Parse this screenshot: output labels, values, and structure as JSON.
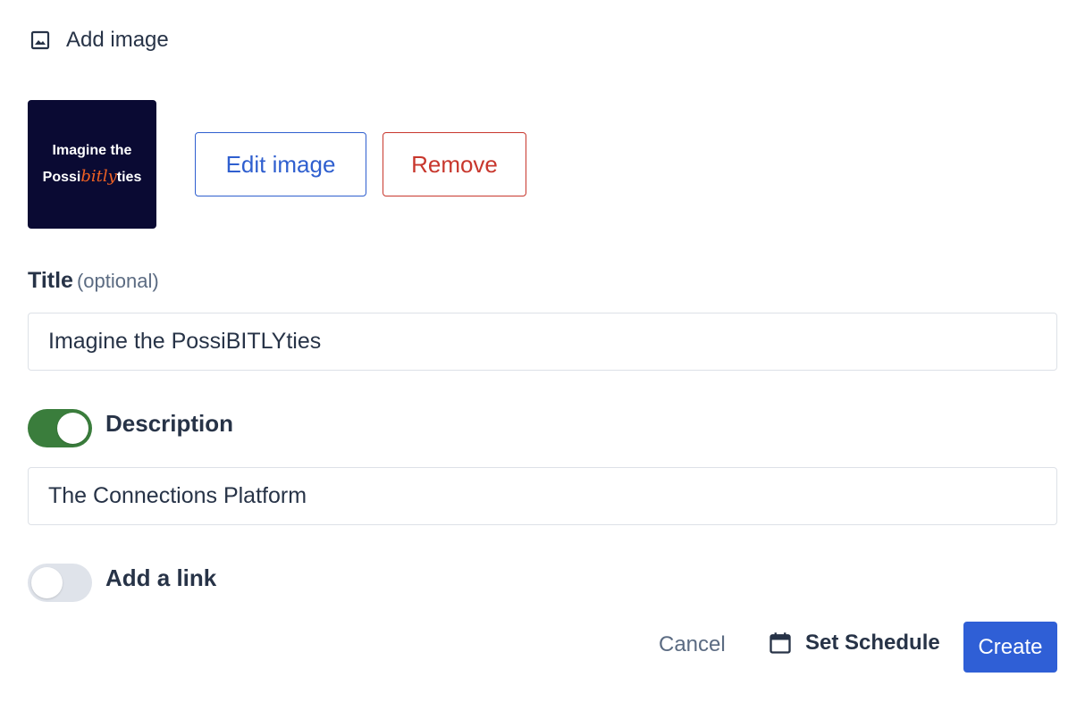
{
  "header": {
    "icon": "image-icon",
    "label": "Add image"
  },
  "thumbnail": {
    "line1": "Imagine the",
    "line2_prefix": "Possi",
    "line2_brand": "bitly",
    "line2_suffix": "ties",
    "background_color": "#0a0a33",
    "brand_color": "#ee6123"
  },
  "actions": {
    "edit_label": "Edit image",
    "remove_label": "Remove"
  },
  "title_field": {
    "label": "Title",
    "optional_hint": "(optional)",
    "value": "Imagine the PossiBITLYties"
  },
  "description": {
    "toggle_on": true,
    "label": "Description",
    "value": "The Connections Platform"
  },
  "link": {
    "toggle_on": false,
    "label": "Add a link"
  },
  "footer": {
    "cancel_label": "Cancel",
    "schedule_icon": "calendar-icon",
    "schedule_label": "Set Schedule",
    "create_label": "Create"
  },
  "colors": {
    "primary": "#2f5fd6",
    "danger": "#c8372d",
    "toggle_on": "#3a7d3c",
    "toggle_off": "#dfe3ea",
    "text": "#273347",
    "muted": "#5b6b82"
  }
}
